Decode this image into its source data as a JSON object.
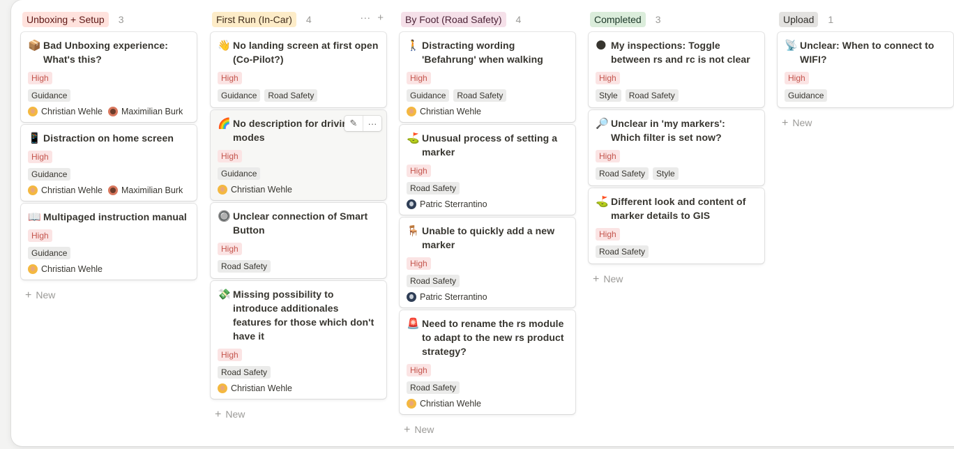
{
  "columns": [
    {
      "title": "Unboxing + Setup",
      "count": "3",
      "title_bg": "#ffe2dd",
      "title_color": "#5d1715",
      "cards": [
        {
          "emoji": "📦",
          "title": "Bad Unboxing experience: What's this?",
          "priority": "High",
          "tags": [
            "Guidance"
          ],
          "people": [
            {
              "name": "Christian Wehle",
              "avatar": "cw"
            },
            {
              "name": "Maximilian Burk",
              "avatar": "mb"
            }
          ]
        },
        {
          "emoji": "📱",
          "title": "Distraction on home screen",
          "priority": "High",
          "tags": [
            "Guidance"
          ],
          "people": [
            {
              "name": "Christian Wehle",
              "avatar": "cw"
            },
            {
              "name": "Maximilian Burk",
              "avatar": "mb"
            }
          ]
        },
        {
          "emoji": "📖",
          "title": "Multipaged instruction manual",
          "priority": "High",
          "tags": [
            "Guidance"
          ],
          "people": [
            {
              "name": "Christian Wehle",
              "avatar": "cw"
            }
          ]
        }
      ],
      "new_label": "New"
    },
    {
      "title": "First Run (In-Car)",
      "count": "4",
      "title_bg": "#fdecc8",
      "title_color": "#402c1b",
      "actions": true,
      "cards": [
        {
          "emoji": "👋",
          "title": "No landing screen at first open (Co-Pilot?)",
          "priority": "High",
          "tags": [
            "Guidance",
            "Road Safety"
          ],
          "people": []
        },
        {
          "emoji": "🌈",
          "title": "No description for driving modes",
          "priority": "High",
          "tags": [
            "Guidance"
          ],
          "people": [
            {
              "name": "Christian Wehle",
              "avatar": "cw"
            }
          ],
          "hovered": true
        },
        {
          "emoji": "🔘",
          "title": "Unclear connection of Smart Button",
          "priority": "High",
          "tags": [
            "Road Safety"
          ],
          "people": []
        },
        {
          "emoji": "💸",
          "title": "Missing possibility to introduce additionales features for those which don't have it",
          "priority": "High",
          "tags": [
            "Road Safety"
          ],
          "people": [
            {
              "name": "Christian Wehle",
              "avatar": "cw"
            }
          ]
        }
      ],
      "new_label": "New"
    },
    {
      "title": "By Foot (Road Safety)",
      "count": "4",
      "title_bg": "#f5e0e9",
      "title_color": "#4c2337",
      "cards": [
        {
          "emoji": "🚶",
          "title": "Distracting wording 'Befahrung' when walking",
          "priority": "High",
          "tags": [
            "Guidance",
            "Road Safety"
          ],
          "people": [
            {
              "name": "Christian Wehle",
              "avatar": "cw"
            }
          ]
        },
        {
          "emoji": "⛳",
          "title": "Unusual process of setting a marker",
          "priority": "High",
          "tags": [
            "Road Safety"
          ],
          "people": [
            {
              "name": "Patric Sterrantino",
              "avatar": "ps"
            }
          ]
        },
        {
          "emoji": "🪑",
          "title": "Unable to quickly add a new marker",
          "priority": "High",
          "tags": [
            "Road Safety"
          ],
          "people": [
            {
              "name": "Patric Sterrantino",
              "avatar": "ps"
            }
          ]
        },
        {
          "emoji": "🚨",
          "title": "Need to rename the rs module to adapt to the new rs product strategy?",
          "priority": "High",
          "tags": [
            "Road Safety"
          ],
          "people": [
            {
              "name": "Christian Wehle",
              "avatar": "cw"
            }
          ]
        }
      ],
      "new_label": "New"
    },
    {
      "title": "Completed",
      "count": "3",
      "title_bg": "#dbeddb",
      "title_color": "#1c3829",
      "cards": [
        {
          "emoji": "🌑",
          "title": "My inspections: Toggle between rs and rc is not clear",
          "priority": "High",
          "tags": [
            "Style",
            "Road Safety"
          ],
          "people": []
        },
        {
          "emoji": "🔎",
          "title": "Unclear in 'my markers': Which filter is set now?",
          "priority": "High",
          "tags": [
            "Road Safety",
            "Style"
          ],
          "people": []
        },
        {
          "emoji": "⛳",
          "title": "Different look and content of marker details to GIS",
          "priority": "High",
          "tags": [
            "Road Safety"
          ],
          "people": []
        }
      ],
      "new_label": "New"
    },
    {
      "title": "Upload",
      "count": "1",
      "title_bg": "#e3e2e0",
      "title_color": "#32302c",
      "cards": [
        {
          "emoji": "📡",
          "title": "Unclear: When to connect to WIFI?",
          "priority": "High",
          "tags": [
            "Guidance"
          ],
          "people": []
        }
      ],
      "new_label": "New"
    }
  ],
  "hover_tools": {
    "edit": "✎",
    "more": "···"
  },
  "column_actions": {
    "more": "···",
    "add": "+"
  }
}
